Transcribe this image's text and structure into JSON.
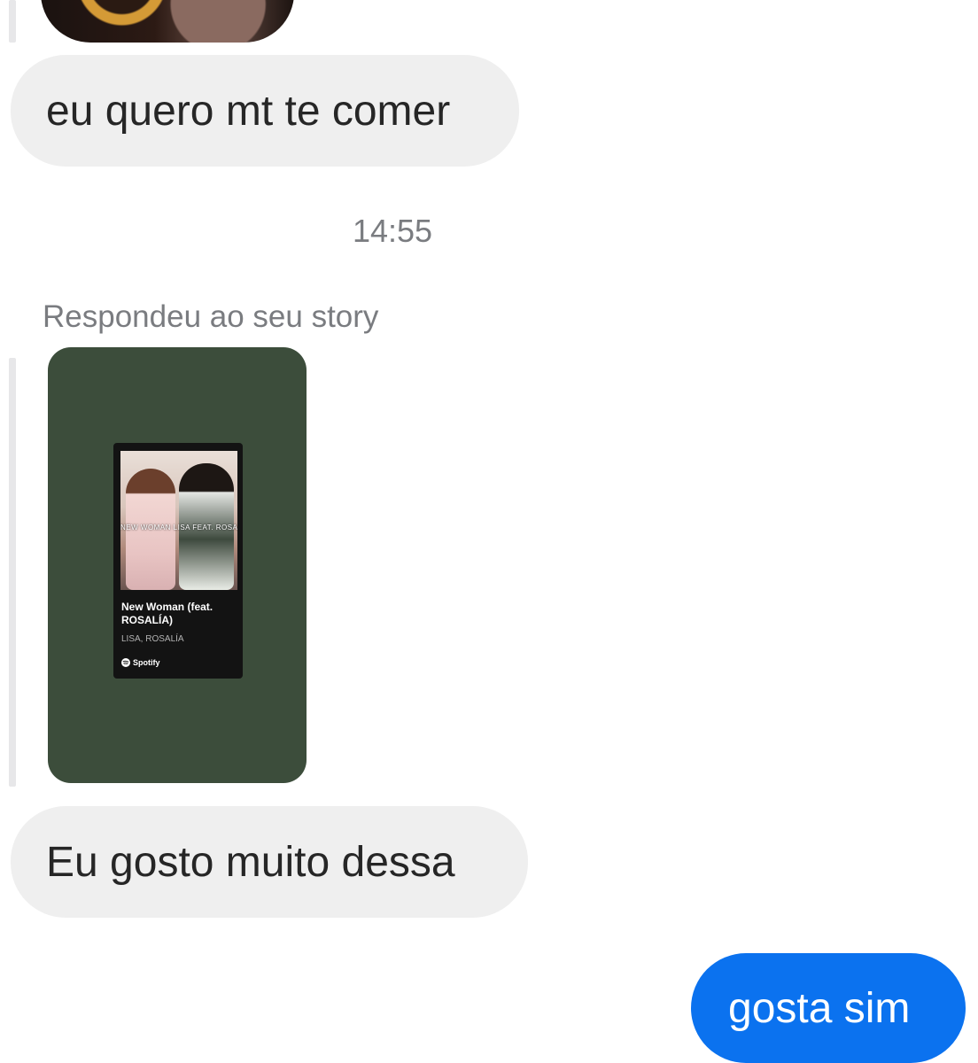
{
  "messages": {
    "received_1": "eu quero mt te comer",
    "timestamp": "14:55",
    "reply_label": "Respondeu ao seu story",
    "received_2": "Eu gosto muito dessa",
    "sent_1": "gosta sim"
  },
  "story": {
    "background_color": "#3c4d3b",
    "album_overlay_text": "NEW WOMAN LISA FEAT. ROSALÍA",
    "track_title": "New Woman (feat. ROSALÍA)",
    "track_artist": "LISA, ROSALÍA",
    "service_label": "Spotify"
  },
  "colors": {
    "received_bubble": "#efefef",
    "sent_bubble": "#0b72ef",
    "meta_text": "#7a7c80"
  }
}
